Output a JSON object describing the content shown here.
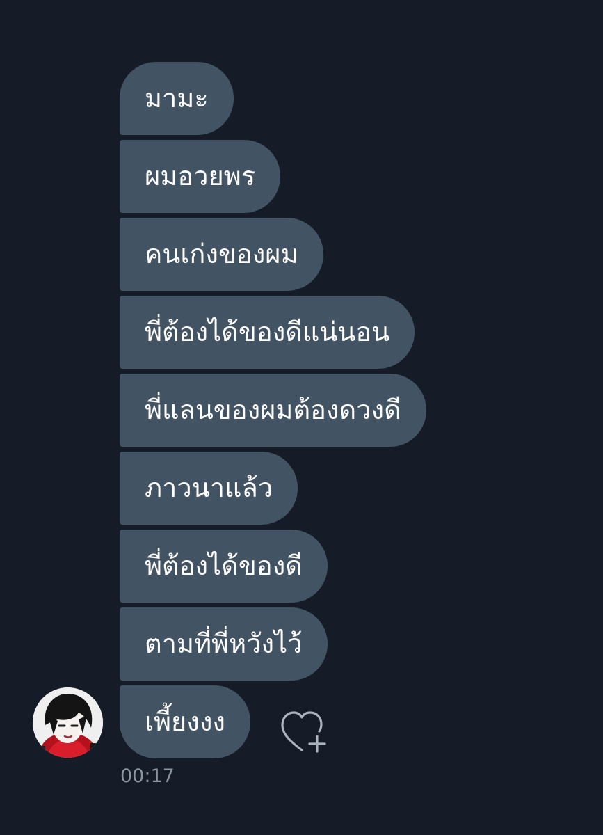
{
  "messages": [
    "มามะ",
    "ผมอวยพร",
    "คนเก่งของผม",
    "พี่ต้องได้ของดีแน่นอน",
    "พี่แลนของผมต้องดวงดี",
    "ภาวนาแล้ว",
    "พี่ต้องได้ของดี",
    "ตามที่พี่หวังไว้",
    "เพี้ยงงง"
  ],
  "timestamp": "00:17",
  "icons": {
    "react": "heart-plus-icon",
    "avatar": "profile-avatar"
  },
  "colors": {
    "background": "#151c27",
    "bubble": "#425364",
    "text": "#ffffff",
    "timestamp": "#8b95a1",
    "icon": "#aab3bd"
  }
}
